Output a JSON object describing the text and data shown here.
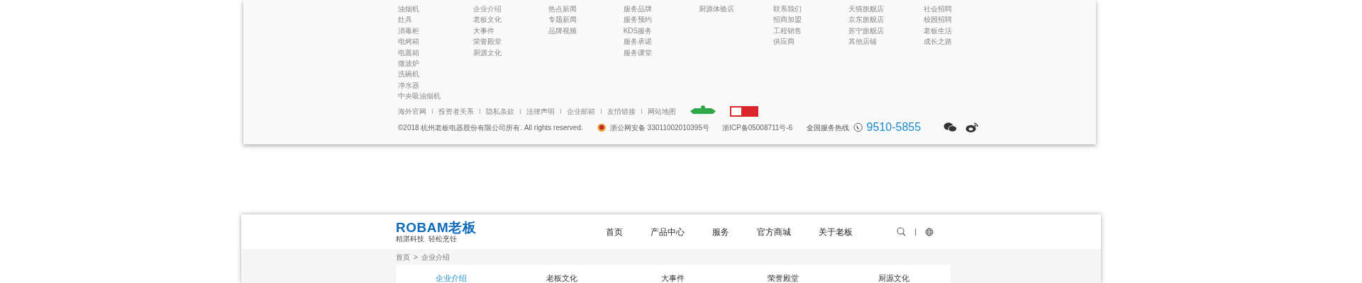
{
  "footer": {
    "columns": [
      [
        "油烟机",
        "灶具",
        "消毒柜",
        "电烤箱",
        "电蒸箱",
        "微波炉",
        "洗碗机",
        "净水器",
        "中央吸油烟机"
      ],
      [
        "企业介绍",
        "老板文化",
        "大事件",
        "荣誉殿堂",
        "厨源文化"
      ],
      [
        "热点新闻",
        "专题新闻",
        "品牌视频"
      ],
      [
        "服务品牌",
        "服务预约",
        "KDS服务",
        "服务承诺",
        "服务课堂"
      ],
      [
        "厨源体验店"
      ],
      [
        "联系我们",
        "招商加盟",
        "工程销售",
        "供应商"
      ],
      [
        "天猫旗舰店",
        "京东旗舰店",
        "苏宁旗舰店",
        "其他店铺"
      ],
      [
        "社会招聘",
        "校园招聘",
        "老板生活",
        "成长之路"
      ]
    ],
    "bottom_links": [
      "海外官网",
      "投资者关系",
      "隐私条款",
      "法律声明",
      "企业邮箱",
      "友情链接",
      "网站地图"
    ],
    "copyright": "©2018 杭州老板电器股份有限公司所有. All rights reserved.",
    "police_record": "浙公网安备 33011002010395号",
    "icp": "浙ICP备05008711号-6",
    "hotline_label": "全国服务热线",
    "hotline": "9510-5855"
  },
  "header": {
    "logo": "ROBAM老板",
    "tagline": "精湛科技  轻松烹饪",
    "nav": [
      {
        "label": "首页",
        "selected": false
      },
      {
        "label": "产品中心",
        "selected": false
      },
      {
        "label": "服务",
        "selected": false
      },
      {
        "label": "官方商城",
        "selected": false
      },
      {
        "label": "关于老板",
        "selected": false
      }
    ],
    "divider": "|"
  },
  "breadcrumb": [
    "首页",
    ">",
    "企业介绍"
  ],
  "tabs": [
    {
      "label": "企业介绍",
      "selected": true
    },
    {
      "label": "老板文化",
      "selected": false
    },
    {
      "label": "大事件",
      "selected": false
    },
    {
      "label": "荣誉殿堂",
      "selected": false
    },
    {
      "label": "厨源文化",
      "selected": false
    }
  ]
}
